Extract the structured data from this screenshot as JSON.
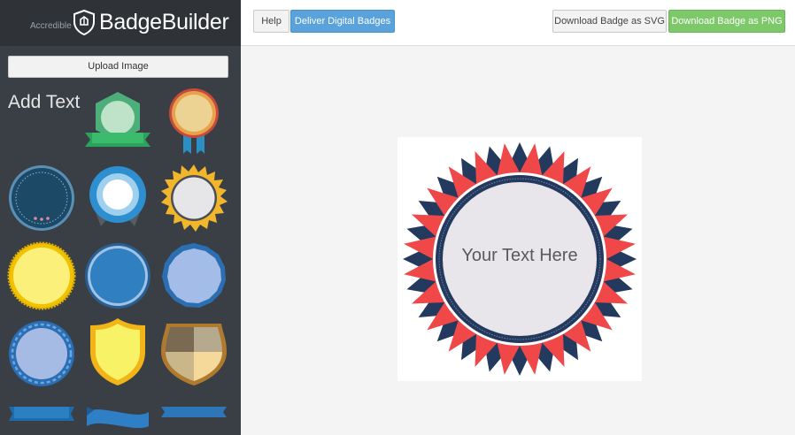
{
  "app": {
    "logo_small": "Accredible",
    "logo_title": "BadgeBuilder"
  },
  "sidebar": {
    "upload_label": "Upload Image",
    "add_text_label": "Add Text"
  },
  "toolbar": {
    "help_label": "Help",
    "deliver_label": "Deliver Digital Badges",
    "download_svg_label": "Download Badge as SVG",
    "download_png_label": "Download Badge as PNG"
  },
  "canvas": {
    "badge_text": "Your Text Here"
  },
  "colors": {
    "sidebar_bg": "#3a3f45",
    "accent_blue": "#5aa2dc",
    "accent_green": "#7dc96a",
    "badge_red": "#f04848",
    "badge_navy": "#233a5e",
    "badge_inner": "#e8e6ea"
  }
}
